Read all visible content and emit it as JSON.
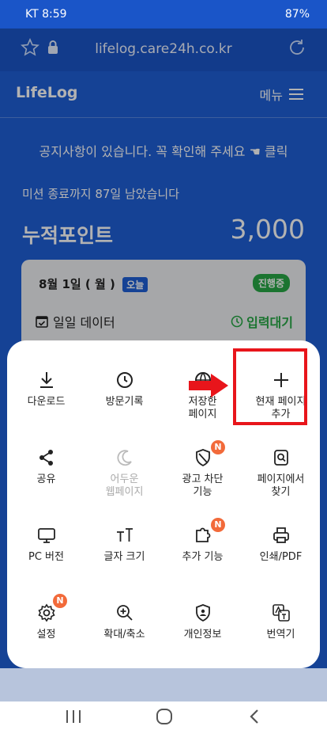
{
  "status": {
    "left": "KT 8:59",
    "right": "87%"
  },
  "browser": {
    "url": "lifelog.care24h.co.kr"
  },
  "app": {
    "logo": "LifeLog",
    "menu_label": "메뉴"
  },
  "main": {
    "notice": "공지사항이 있습니다. 꼭 확인해 주세요 ☚ 클릭",
    "mission": "미션 종료까지 87일 남았습니다",
    "points_label": "누적포인트",
    "points_value": "3,000",
    "card": {
      "date": "8월 1일 ( 월 )",
      "today": "오늘",
      "progress": "진행중",
      "daily": "일일 데이터",
      "waiting": "입력대기"
    }
  },
  "menu_sheet": {
    "items": [
      {
        "label": "다운로드",
        "icon": "download-icon"
      },
      {
        "label": "방문기록",
        "icon": "clock-icon"
      },
      {
        "label": "저장한\n페이지",
        "icon": "saved-pages-icon"
      },
      {
        "label": "현재 페이지\n추가",
        "icon": "plus-icon"
      },
      {
        "label": "공유",
        "icon": "share-icon"
      },
      {
        "label": "어두운\n웹페이지",
        "icon": "moon-icon"
      },
      {
        "label": "광고 차단\n기능",
        "icon": "ad-block-icon",
        "badge": "N"
      },
      {
        "label": "페이지에서\n찾기",
        "icon": "find-in-page-icon"
      },
      {
        "label": "PC 버전",
        "icon": "desktop-icon"
      },
      {
        "label": "글자 크기",
        "icon": "text-size-icon"
      },
      {
        "label": "추가 기능",
        "icon": "add-ons-icon",
        "badge": "N"
      },
      {
        "label": "인쇄/PDF",
        "icon": "print-icon"
      },
      {
        "label": "설정",
        "icon": "settings-icon",
        "badge": "N"
      },
      {
        "label": "확대/축소",
        "icon": "zoom-icon"
      },
      {
        "label": "개인정보",
        "icon": "privacy-icon"
      },
      {
        "label": "번역기",
        "icon": "translate-icon"
      }
    ]
  },
  "colors": {
    "primary": "#1f5fd6",
    "green": "#27a745",
    "highlight": "#e8151b",
    "badge": "#f26a3a"
  }
}
